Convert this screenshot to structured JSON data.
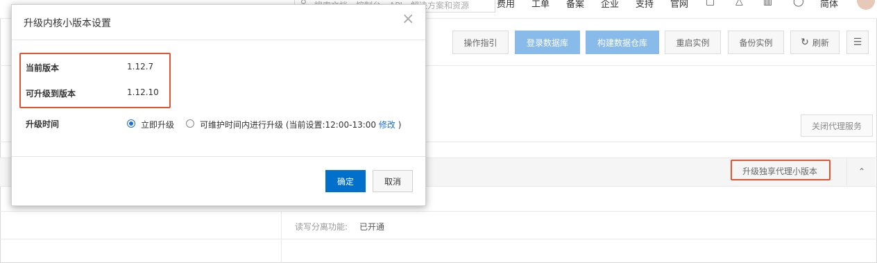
{
  "topnav": {
    "search_placeholder": "搜索文档、控制台、API、解决方案和资源",
    "items": [
      "费用",
      "工单",
      "备案",
      "企业",
      "支持",
      "官网"
    ],
    "language": "简体"
  },
  "toolbar": {
    "guide": "操作指引",
    "login_db": "登录数据库",
    "build_warehouse": "构建数据仓库",
    "restart": "重启实例",
    "backup": "备份实例",
    "refresh": "刷新"
  },
  "proxy": {
    "close_service": "关闭代理服务",
    "upgrade_minor": "升级独享代理小版本"
  },
  "info": {
    "rw_split_label": "读写分离功能:",
    "rw_split_value": "已开通"
  },
  "dialog": {
    "title": "升级内核小版本设置",
    "current_version_label": "当前版本",
    "current_version_value": "1.12.7",
    "upgradable_label": "可升级到版本",
    "upgradable_value": "1.12.10",
    "upgrade_time_label": "升级时间",
    "option_now": "立即升级",
    "option_maintenance": "可维护时间内进行升级 (当前设置:12:00-13:00",
    "modify_link": "修改",
    "close_paren": ")",
    "ok": "确定",
    "cancel": "取消"
  },
  "colors": {
    "primary": "#0070cc",
    "highlight_box": "#e2542f",
    "light_blue_button": "#88bbe9"
  }
}
